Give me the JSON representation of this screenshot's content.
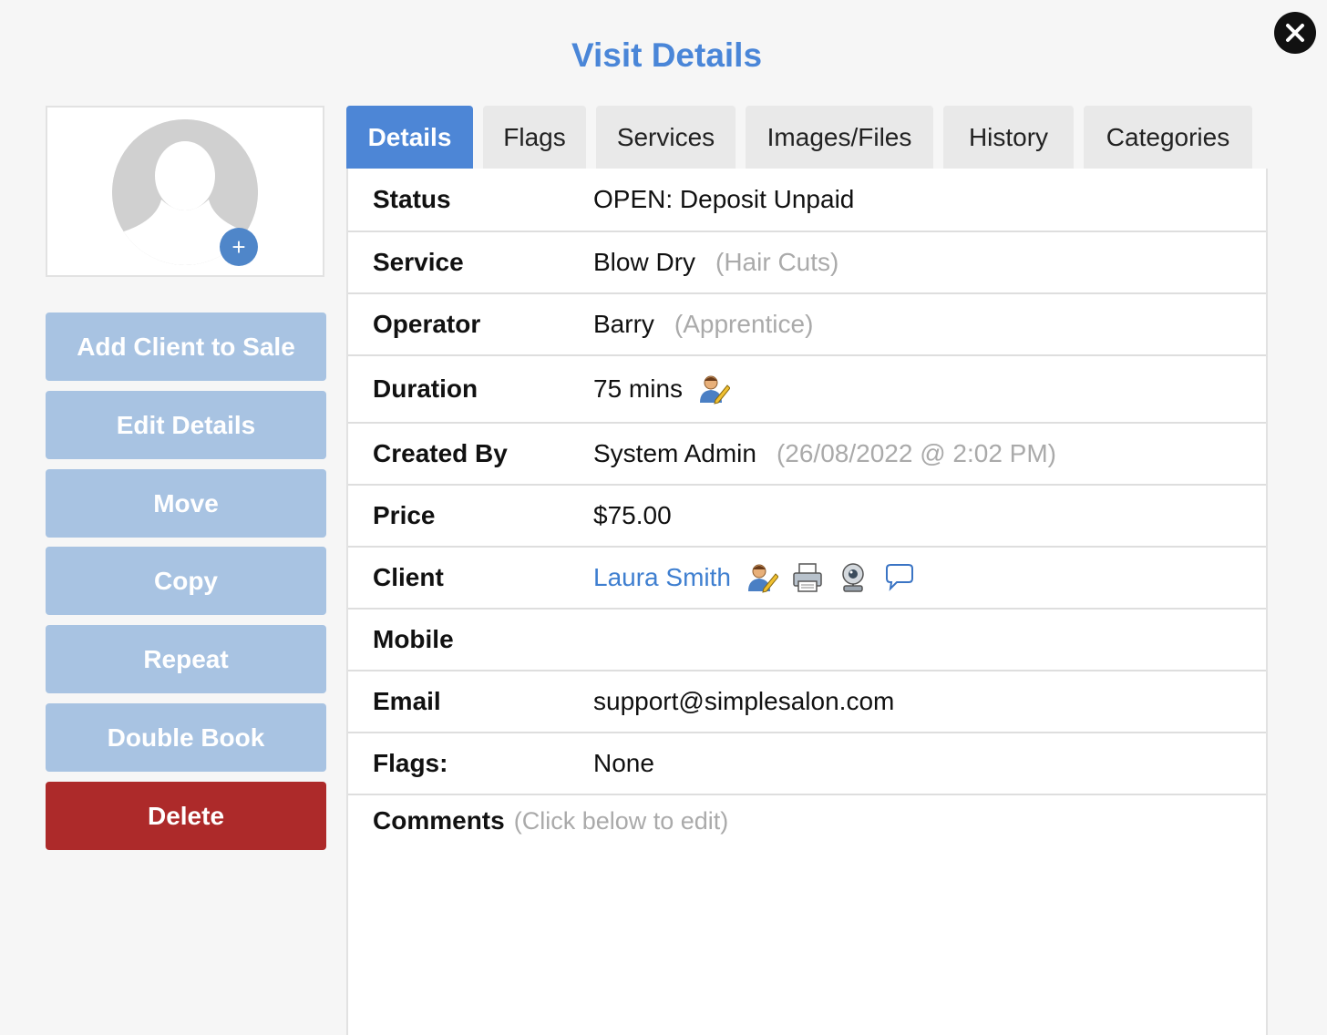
{
  "dialog": {
    "title": "Visit Details",
    "close_icon": "close-icon"
  },
  "avatar": {
    "icon": "user-silhouette-icon",
    "add_icon": "plus-icon",
    "add_label": "+"
  },
  "actions": {
    "add_client_to_sale": "Add Client to Sale",
    "edit_details": "Edit Details",
    "move": "Move",
    "copy": "Copy",
    "repeat": "Repeat",
    "double_book": "Double Book",
    "delete": "Delete"
  },
  "tabs": [
    {
      "label": "Details",
      "active": true
    },
    {
      "label": "Flags",
      "active": false
    },
    {
      "label": "Services",
      "active": false
    },
    {
      "label": "Images/Files",
      "active": false
    },
    {
      "label": "History",
      "active": false
    },
    {
      "label": "Categories",
      "active": false
    }
  ],
  "details": {
    "status": {
      "label": "Status",
      "value": "OPEN: Deposit Unpaid"
    },
    "service": {
      "label": "Service",
      "value": "Blow Dry",
      "note": "(Hair Cuts)"
    },
    "operator": {
      "label": "Operator",
      "value": "Barry",
      "note": "(Apprentice)"
    },
    "duration": {
      "label": "Duration",
      "value": "75 mins",
      "icon": "edit-person-icon"
    },
    "created_by": {
      "label": "Created By",
      "value": "System Admin",
      "note": "(26/08/2022 @ 2:02 PM)"
    },
    "price": {
      "label": "Price",
      "value": "$75.00"
    },
    "client": {
      "label": "Client",
      "value": "Laura Smith",
      "icons": [
        "edit-person-icon",
        "printer-icon",
        "webcam-icon",
        "message-bubble-icon"
      ]
    },
    "mobile": {
      "label": "Mobile",
      "value": ""
    },
    "email": {
      "label": "Email",
      "value": "support@simplesalon.com"
    },
    "flags": {
      "label": "Flags:",
      "value": "None"
    },
    "comments": {
      "label": "Comments",
      "hint": "(Click below to edit)"
    }
  },
  "colors": {
    "title": "#4a86d8",
    "tab_active": "#4d86d6",
    "action_button": "#a8c3e2",
    "delete_button": "#ad2a2a",
    "link": "#3f7fd0",
    "muted": "#aaaaaa"
  }
}
